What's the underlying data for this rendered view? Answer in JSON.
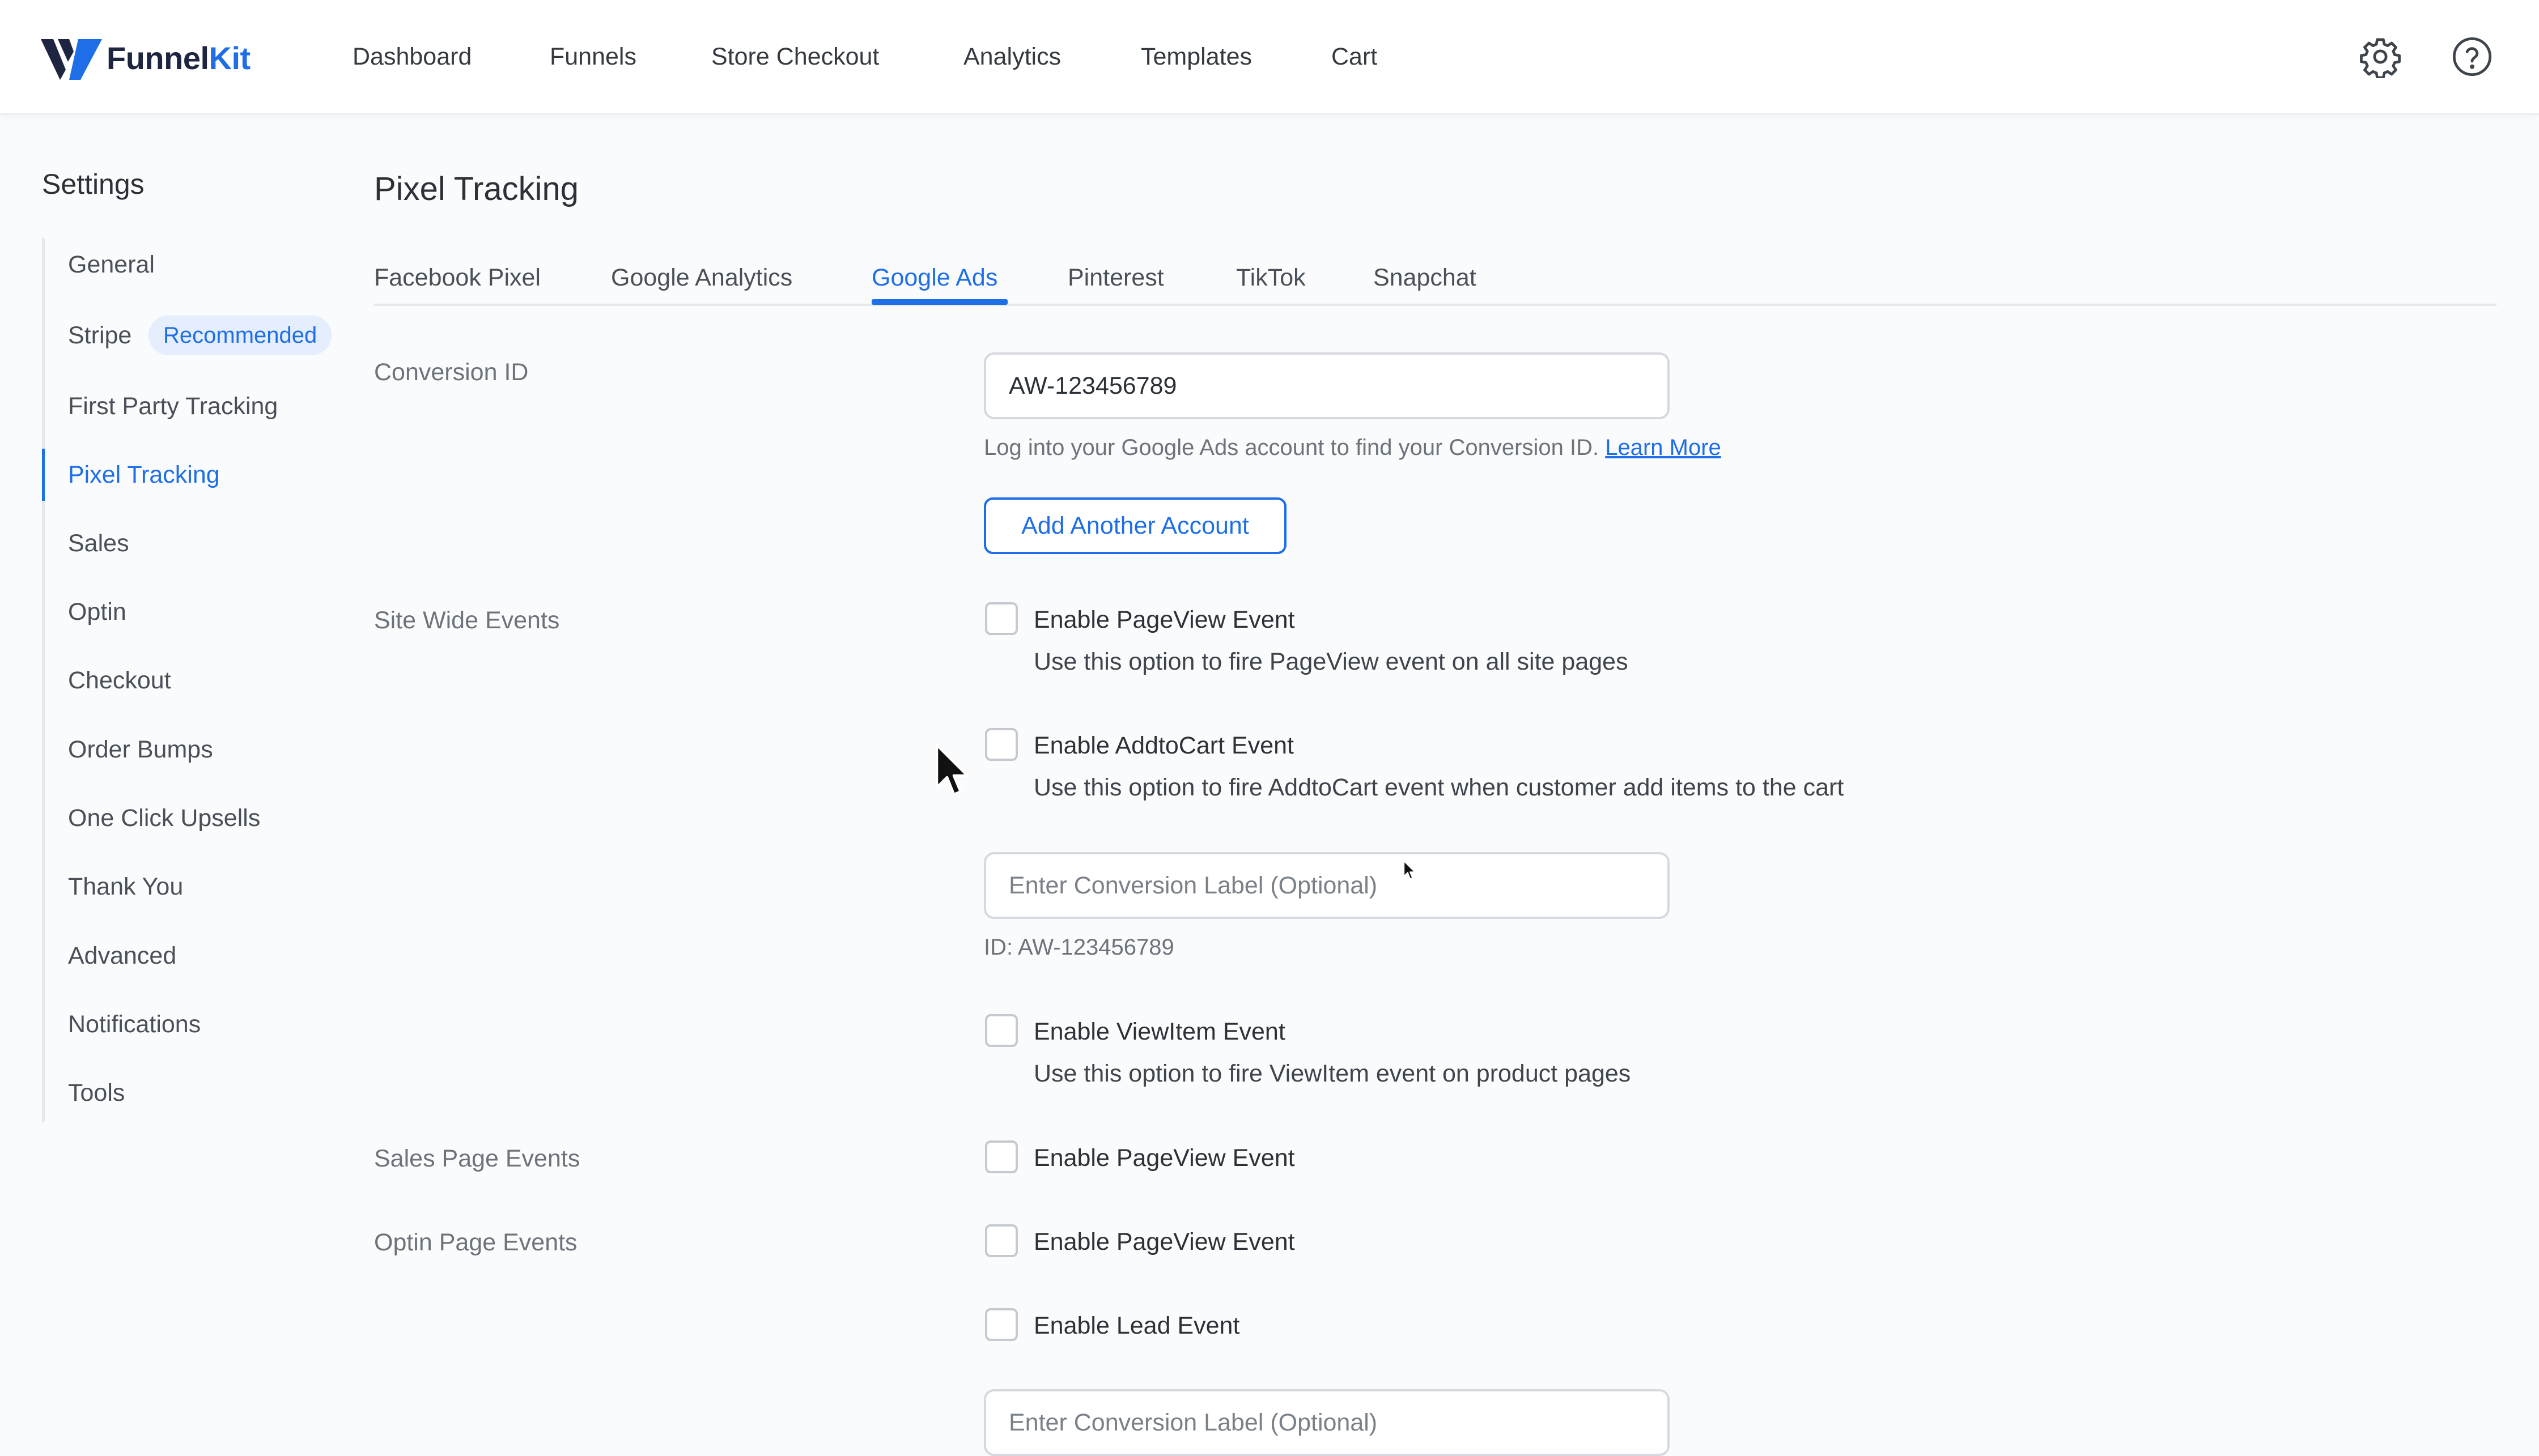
{
  "brand": {
    "name_part1": "Funnel",
    "name_part2": "Kit"
  },
  "topnav": {
    "items": [
      "Dashboard",
      "Funnels",
      "Store Checkout",
      "Analytics",
      "Templates",
      "Cart"
    ]
  },
  "header_icons": [
    "gear-icon",
    "help-icon"
  ],
  "sidebar": {
    "title": "Settings",
    "items": [
      {
        "label": "General"
      },
      {
        "label": "Stripe",
        "badge": "Recommended"
      },
      {
        "label": "First Party Tracking"
      },
      {
        "label": "Pixel Tracking",
        "active": true
      },
      {
        "label": "Sales"
      },
      {
        "label": "Optin"
      },
      {
        "label": "Checkout"
      },
      {
        "label": "Order Bumps"
      },
      {
        "label": "One Click Upsells"
      },
      {
        "label": "Thank You"
      },
      {
        "label": "Advanced"
      },
      {
        "label": "Notifications"
      },
      {
        "label": "Tools"
      }
    ]
  },
  "main": {
    "title": "Pixel Tracking",
    "tabs": [
      "Facebook Pixel",
      "Google Analytics",
      "Google Ads",
      "Pinterest",
      "TikTok",
      "Snapchat"
    ],
    "active_tab": "Google Ads",
    "conversion": {
      "label": "Conversion ID",
      "value": "AW-123456789",
      "help_text": "Log into your Google Ads account to find your Conversion ID.",
      "help_link": "Learn More",
      "add_account_button": "Add Another Account"
    },
    "site_wide": {
      "label": "Site Wide Events",
      "pageview": {
        "label": "Enable PageView Event",
        "desc": "Use this option to fire PageView event on all site pages",
        "checked": false
      },
      "addtocart": {
        "label": "Enable AddtoCart Event",
        "desc": "Use this option to fire AddtoCart event when customer add items to the cart",
        "checked": false
      },
      "addtocart_label_placeholder": "Enter Conversion Label (Optional)",
      "id_note": "ID: AW-123456789",
      "viewitem": {
        "label": "Enable ViewItem Event",
        "desc": "Use this option to fire ViewItem event on product pages",
        "checked": false
      }
    },
    "sales_page": {
      "label": "Sales Page Events",
      "pageview": {
        "label": "Enable PageView Event",
        "checked": false
      }
    },
    "optin_page": {
      "label": "Optin Page Events",
      "pageview": {
        "label": "Enable PageView Event",
        "checked": false
      },
      "lead": {
        "label": "Enable Lead Event",
        "checked": false
      },
      "lead_label_placeholder": "Enter Conversion Label (Optional)"
    }
  },
  "colors": {
    "accent": "#1e6ee8",
    "badge_bg": "#e4eefc",
    "border": "#d6d9de"
  }
}
